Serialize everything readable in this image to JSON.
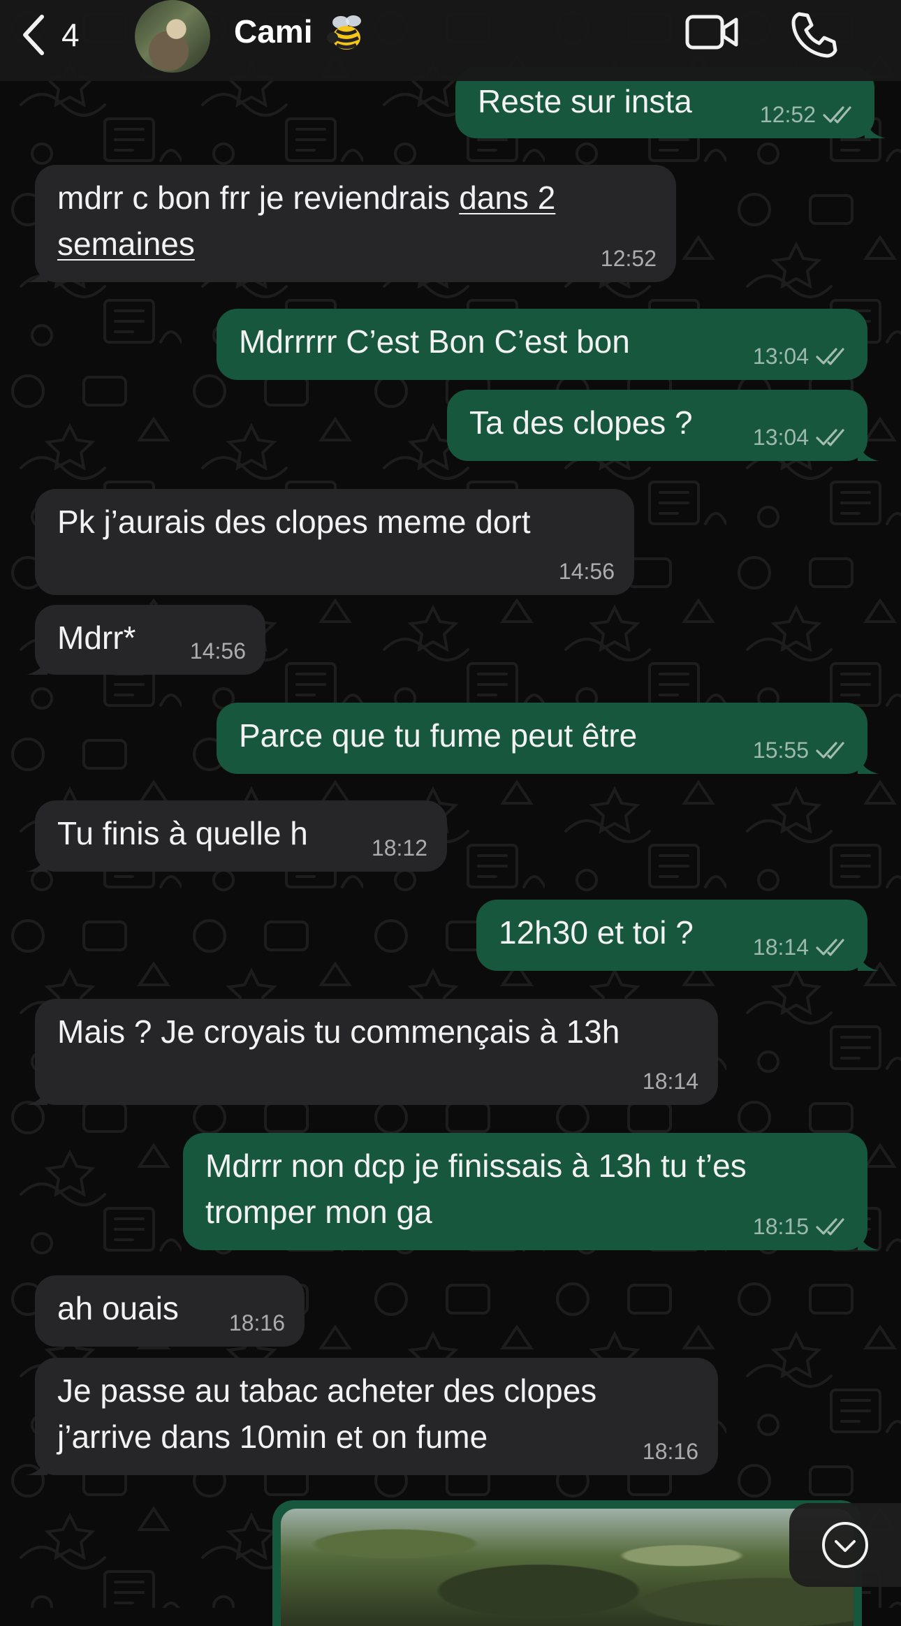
{
  "header": {
    "back_count": "4",
    "contact_name": "Cami",
    "contact_emoji": "🐝",
    "video_call_icon": "video-camera-icon",
    "voice_call_icon": "phone-icon"
  },
  "colors": {
    "background": "#0b0b0b",
    "incoming_bubble": "#262628",
    "outgoing_bubble": "#17573e",
    "text": "#f2f2f2"
  },
  "messages": [
    {
      "direction": "out",
      "text": "Reste sur insta",
      "time": "12:52",
      "status": "read"
    },
    {
      "direction": "in",
      "text_before": "mdrr c bon frr je reviendrais ",
      "text_link": "dans 2\nsemaines",
      "time": "12:52"
    },
    {
      "direction": "out",
      "text": "Mdrrrrr C’est Bon C’est bon",
      "time": "13:04",
      "status": "read"
    },
    {
      "direction": "out",
      "text": "Ta des clopes ?",
      "time": "13:04",
      "status": "read"
    },
    {
      "direction": "in",
      "text": "Pk j’aurais des clopes meme dort",
      "time": "14:56"
    },
    {
      "direction": "in",
      "text": "Mdrr*",
      "time": "14:56"
    },
    {
      "direction": "out",
      "text": "Parce que tu fume peut être",
      "time": "15:55",
      "status": "read"
    },
    {
      "direction": "in",
      "text": "Tu finis à quelle h",
      "time": "18:12"
    },
    {
      "direction": "out",
      "text": "12h30 et toi ?",
      "time": "18:14",
      "status": "read"
    },
    {
      "direction": "in",
      "text": "Mais ? Je croyais tu commençais à 13h",
      "time": "18:14"
    },
    {
      "direction": "out",
      "text": "Mdrrr non dcp je finissais à 13h tu t’es\ntromper mon ga",
      "time": "18:15",
      "status": "read"
    },
    {
      "direction": "in",
      "text": "ah ouais",
      "time": "18:16"
    },
    {
      "direction": "in",
      "text": "Je passe au tabac acheter des clopes\nj’arrive dans 10min et on fume",
      "time": "18:16"
    }
  ],
  "attachment": {
    "type": "photo",
    "icon": "image-icon"
  },
  "scroll_down_icon": "chevron-down-circle-icon"
}
